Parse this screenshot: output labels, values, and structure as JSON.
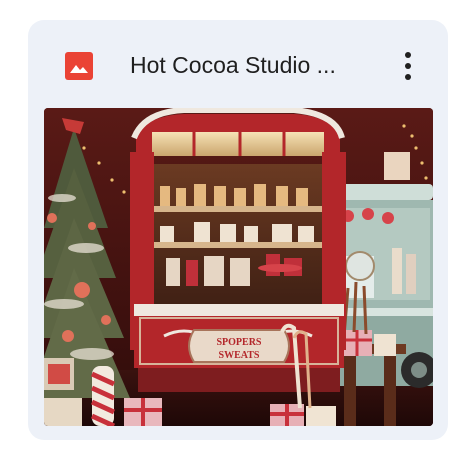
{
  "card": {
    "title": "Hot Cocoa Studio ...",
    "file_type_icon": "image-icon",
    "more_icon": "more-vertical-icon",
    "thumbnail": {
      "description_icon": "image-thumbnail",
      "sign_text_line1": "SPOPERS",
      "sign_text_line2": "SWEATS"
    }
  },
  "colors": {
    "card_bg": "#edf1f8",
    "icon_red": "#ea4335",
    "title_text": "#1f1f1f",
    "cart_red": "#b3262a"
  }
}
